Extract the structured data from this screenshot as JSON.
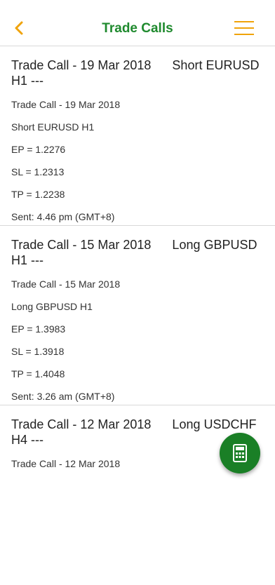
{
  "header": {
    "title": "Trade Calls",
    "back_icon": "chevron-left-icon",
    "menu_icon": "hamburger-menu-icon",
    "accent_color": "#f0a30a",
    "title_color": "#1f8a2e"
  },
  "trades": [
    {
      "title": "Trade Call - 19 Mar 2018      Short EURUSD H1 ---",
      "date_line": "Trade Call - 19 Mar 2018",
      "direction_line": "Short EURUSD H1",
      "ep": "EP = 1.2276",
      "sl": "SL = 1.2313",
      "tp": "TP = 1.2238",
      "sent": "Sent: 4.46 pm (GMT+8)"
    },
    {
      "title": "Trade Call - 15 Mar 2018      Long GBPUSD H1 ---",
      "date_line": "Trade Call - 15 Mar 2018",
      "direction_line": "Long GBPUSD H1",
      "ep": "EP = 1.3983",
      "sl": "SL = 1.3918",
      "tp": "TP = 1.4048",
      "sent": "Sent: 3.26 am (GMT+8)"
    },
    {
      "title": "Trade Call - 12 Mar 2018      Long USDCHF H4 ---",
      "date_line": "Trade Call - 12 Mar 2018"
    }
  ],
  "fab": {
    "icon": "calculator-icon",
    "color": "#1a7f26"
  }
}
